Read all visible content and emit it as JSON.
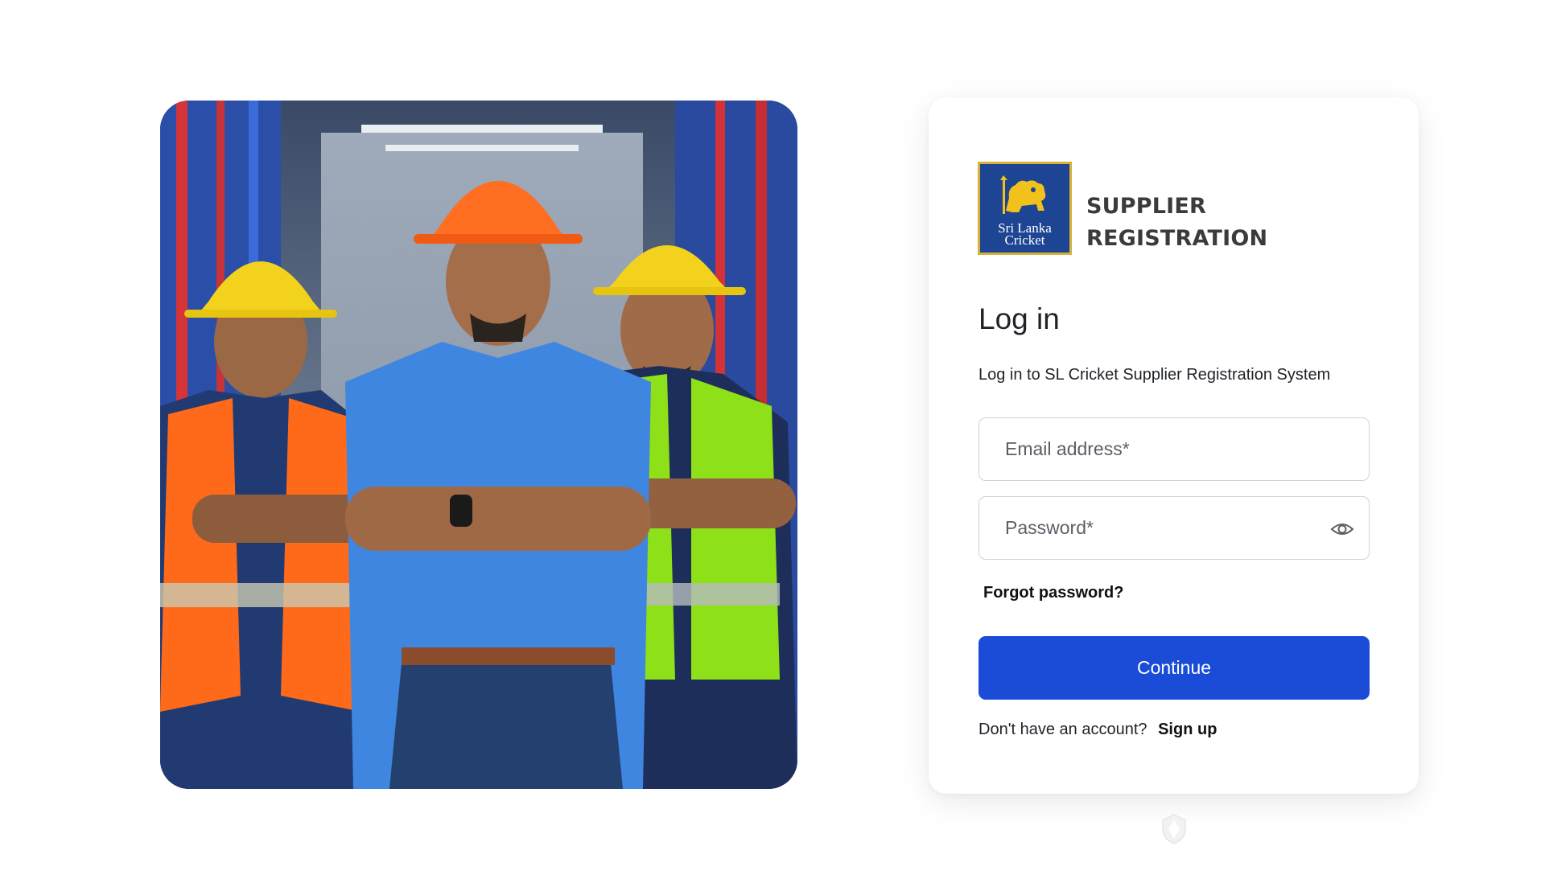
{
  "brand": {
    "logo_text_line1": "Sri Lanka",
    "logo_text_line2": "Cricket",
    "title_line1": "SUPPLIER",
    "title_line2": "REGISTRATION"
  },
  "login": {
    "heading": "Log in",
    "subtitle": "Log in to SL Cricket Supplier Registration System",
    "email_placeholder": "Email address*",
    "password_placeholder": "Password*",
    "forgot_password": "Forgot password?",
    "continue_label": "Continue",
    "signup_prompt": "Don't have an account?",
    "signup_link": "Sign up"
  },
  "icons": {
    "password_toggle": "eye-icon",
    "bottom_mark": "shield-icon"
  },
  "colors": {
    "primary_button": "#1a4cd8",
    "logo_background": "#1d4593",
    "logo_border": "#d8b13a"
  }
}
